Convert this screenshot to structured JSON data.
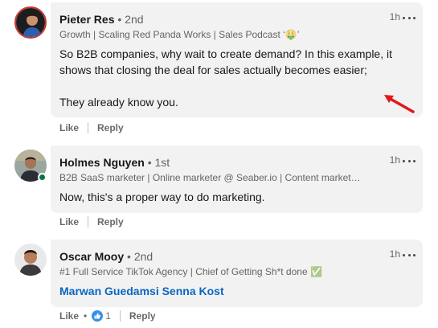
{
  "comments": [
    {
      "name": "Pieter Res",
      "degree": "2nd",
      "headline": "Growth | Scaling Red Panda Works | Sales Podcast ‘🤑’",
      "time": "1h",
      "lines": [
        "So B2B companies, why wait to create demand? In this example, it",
        "shows that closing the deal for sales actually becomes easier;",
        "They already know you."
      ],
      "like_label": "Like",
      "reply_label": "Reply"
    },
    {
      "name": "Holmes Nguyen",
      "degree": "1st",
      "headline": "B2B SaaS marketer | Online marketer @ Seaber.io | Content market…",
      "time": "1h",
      "lines": [
        "Now, this's a proper way to do marketing."
      ],
      "like_label": "Like",
      "reply_label": "Reply"
    },
    {
      "name": "Oscar Mooy",
      "degree": "2nd",
      "headline": "#1 Full Service TikTok Agency | Chief of Getting Sh*t done ✅",
      "time": "1h",
      "mention": "Marwan Guedamsi Senna Kost",
      "like_label": "Like",
      "reaction_count": "1",
      "reply_label": "Reply"
    }
  ],
  "separator": "•",
  "colors": {
    "bubble": "#f2f2f2",
    "link": "#0a66c2",
    "online": "#057642",
    "annotation_arrow": "#e0191b"
  },
  "icons": {
    "more": "ellipsis-icon",
    "like_reaction": "thumbs-up-reaction-icon",
    "annotation": "red-arrow-icon"
  }
}
